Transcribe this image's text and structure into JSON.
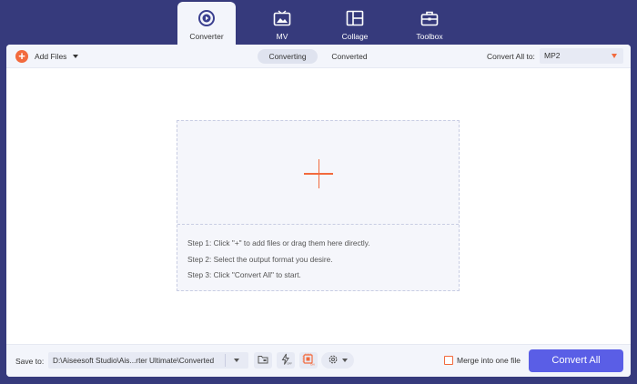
{
  "nav": {
    "tabs": [
      {
        "label": "Converter",
        "icon": "converter-icon",
        "active": true
      },
      {
        "label": "MV",
        "icon": "mv-icon",
        "active": false
      },
      {
        "label": "Collage",
        "icon": "collage-icon",
        "active": false
      },
      {
        "label": "Toolbox",
        "icon": "toolbox-icon",
        "active": false
      }
    ]
  },
  "toolbar": {
    "add_files_label": "Add Files",
    "segments": [
      "Converting",
      "Converted"
    ],
    "active_segment": "Converting",
    "convert_all_to_label": "Convert All to:",
    "format_value": "MP2"
  },
  "dropzone": {
    "steps": [
      "Step 1: Click \"+\" to add files or drag them here directly.",
      "Step 2: Select the output format you desire.",
      "Step 3: Click \"Convert All\" to start."
    ]
  },
  "bottombar": {
    "save_to_label": "Save to:",
    "save_path": "D:\\Aiseesoft Studio\\Ais...rter Ultimate\\Converted",
    "merge_label": "Merge into one file",
    "merge_checked": false,
    "convert_all_label": "Convert All"
  },
  "colors": {
    "frame": "#363a7c",
    "accent_orange": "#f26a3d",
    "primary_button": "#5a5ee6",
    "toolbar_bg": "#f3f5fb"
  }
}
